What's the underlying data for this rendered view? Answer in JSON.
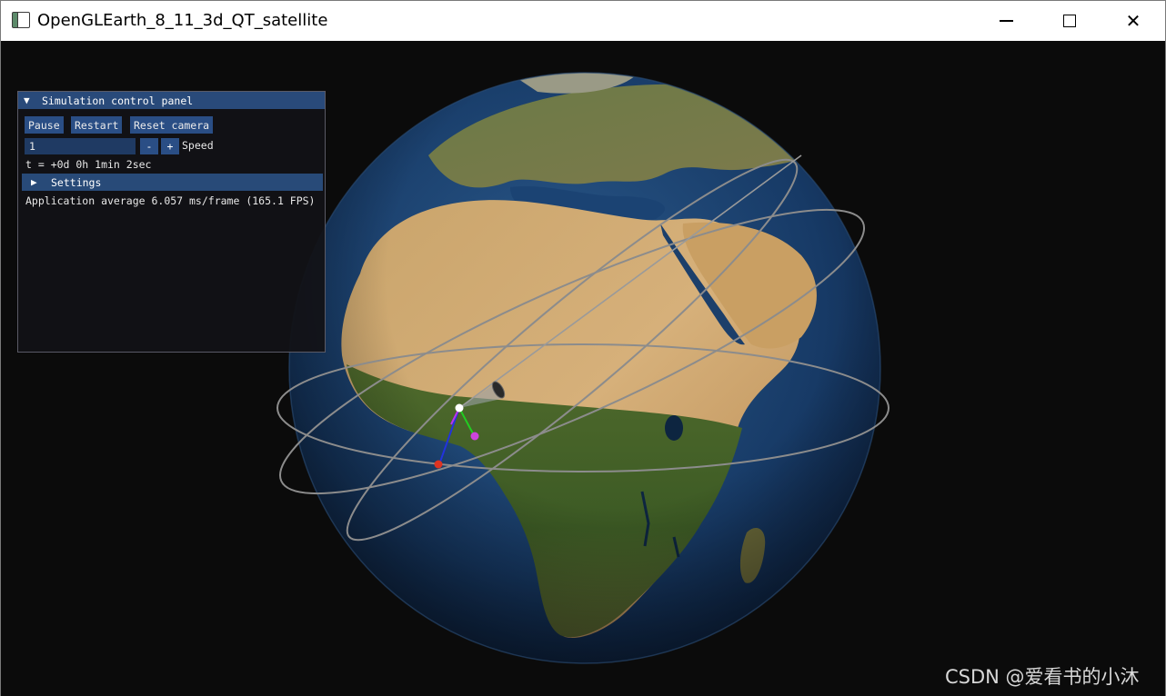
{
  "window": {
    "title": "OpenGLEarth_8_11_3d_QT_satellite",
    "icon": "application-window-icon",
    "controls": [
      "minimize-icon",
      "maximize-icon",
      "close-icon"
    ],
    "close_glyph": "✕"
  },
  "panel": {
    "header_arrow": "▼",
    "header": "Simulation control panel",
    "buttons": {
      "pause": "Pause",
      "restart": "Restart",
      "reset_camera": "Reset camera"
    },
    "speed": {
      "value": "1",
      "minus": "-",
      "plus": "+",
      "label": "Speed"
    },
    "time": "t = +0d 0h 1min 2sec",
    "settings_arrow": "▶",
    "settings": "Settings",
    "fps": "Application average 6.057 ms/frame (165.1 FPS)"
  },
  "scene": {
    "description_icons": [
      "earth-globe",
      "satellite-orbit",
      "satellite-marker",
      "camera-frustum",
      "axis-triad"
    ]
  },
  "watermark": "CSDN @爱看书的小沐",
  "colors": {
    "panel_header": "#294a7a",
    "button": "#2a4e85",
    "background": "#0b0b0b",
    "orbit": "#8c8c8c"
  }
}
